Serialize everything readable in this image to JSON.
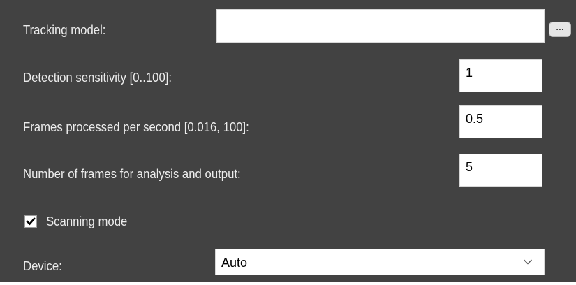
{
  "tracking_model": {
    "label": "Tracking model:",
    "value": "",
    "browse_label": "..."
  },
  "detection_sensitivity": {
    "label": "Detection sensitivity [0..100]:",
    "value": "1"
  },
  "frames_per_second": {
    "label": "Frames processed per second [0.016, 100]:",
    "value": "0.5"
  },
  "frames_for_analysis": {
    "label": "Number of frames for analysis and output:",
    "value": "5"
  },
  "scanning_mode": {
    "label": "Scanning mode",
    "checked": true
  },
  "device": {
    "label": "Device:",
    "selected": "Auto"
  },
  "icons": {
    "checkbox": "check-icon",
    "dropdown": "chevron-down-icon"
  },
  "colors": {
    "panel_background": "#424242",
    "label_text": "#ececec",
    "field_background": "#ffffff"
  }
}
